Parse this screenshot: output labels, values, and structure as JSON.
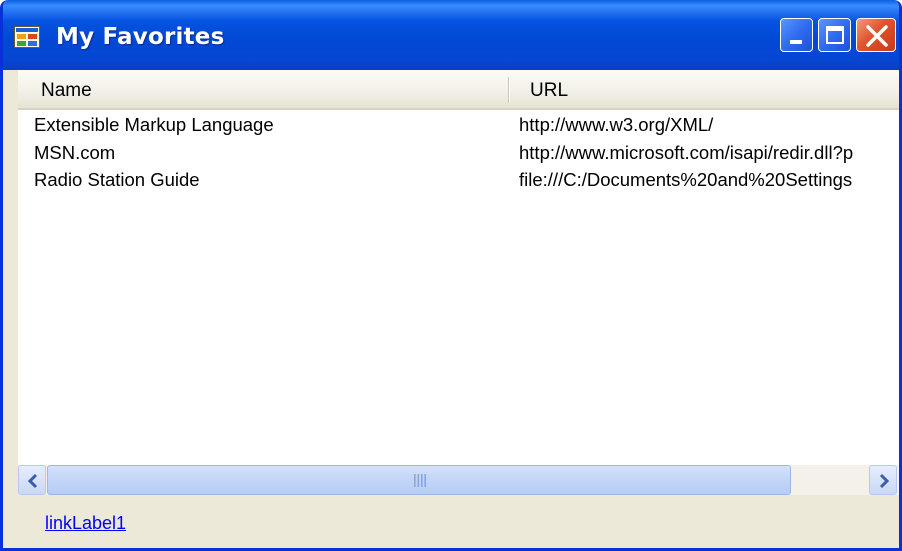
{
  "window": {
    "title": "My Favorites",
    "icon": "app-window-icon",
    "controls": [
      "minimize-icon",
      "maximize-icon",
      "close-icon"
    ]
  },
  "listview": {
    "columns": [
      {
        "label": "Name"
      },
      {
        "label": "URL"
      }
    ],
    "rows": [
      {
        "name": "Extensible Markup Language",
        "url": "http://www.w3.org/XML/"
      },
      {
        "name": "MSN.com",
        "url": "http://www.microsoft.com/isapi/redir.dll?p"
      },
      {
        "name": "Radio Station Guide",
        "url": "file:///C:/Documents%20and%20Settings"
      }
    ]
  },
  "scrollbar": {
    "left_arrow": "chevron-left-icon",
    "right_arrow": "chevron-right-icon"
  },
  "footer": {
    "link_label": "linkLabel1"
  },
  "colors": {
    "titlebar": "#0553e0",
    "window_bg": "#ece9d8",
    "link": "#0000ff",
    "close_button": "#e2522e"
  }
}
